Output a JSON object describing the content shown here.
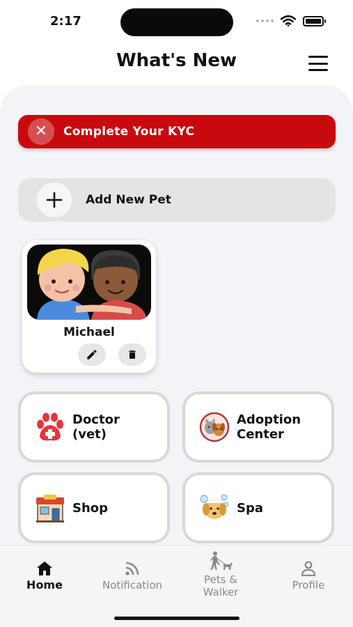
{
  "status_bar": {
    "time": "2:17"
  },
  "header": {
    "title": "What's New",
    "menu_icon": "hamburger-menu-icon"
  },
  "kyc_banner": {
    "text": "Complete Your KYC",
    "icon": "close-icon",
    "color": "#c80a0f"
  },
  "add_pet": {
    "label": "Add New Pet",
    "icon": "plus-icon"
  },
  "pets": [
    {
      "name": "Michael",
      "photo": "two-cartoon-boys-avatar",
      "actions": [
        "edit-icon",
        "trash-icon"
      ]
    }
  ],
  "services": [
    {
      "label": "Doctor\n(vet)",
      "icon": "paw-medical-icon"
    },
    {
      "label": "Adoption\nCenter",
      "icon": "adoption-pets-icon"
    },
    {
      "label": "Shop",
      "icon": "pet-shop-icon"
    },
    {
      "label": "Spa",
      "icon": "dog-spa-icon"
    }
  ],
  "bottom_nav": {
    "items": [
      {
        "label": "Home",
        "icon": "home-icon",
        "active": true
      },
      {
        "label": "Notification",
        "icon": "rss-icon",
        "active": false
      },
      {
        "label": "Pets &\nWalker",
        "icon": "dog-walker-icon",
        "active": false
      },
      {
        "label": "Profile",
        "icon": "user-icon",
        "active": false
      }
    ]
  },
  "colors": {
    "accent": "#c80a0f",
    "background": "#f2f4f7",
    "card_border": "#d8d8d8"
  }
}
